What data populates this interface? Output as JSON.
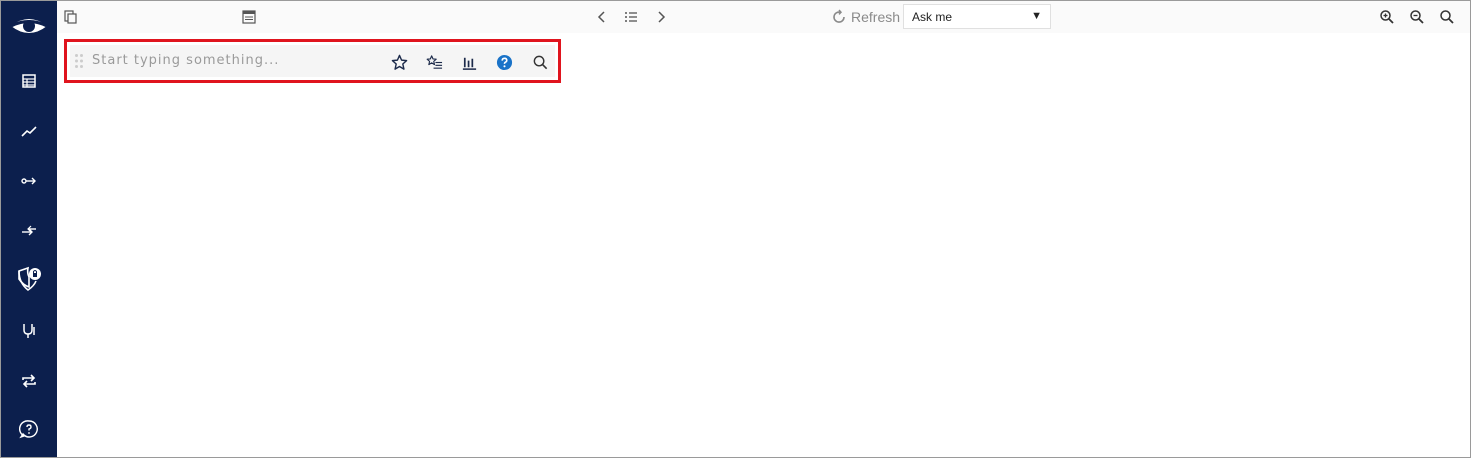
{
  "sidebar": {
    "logo": "eye-logo",
    "items": [
      {
        "icon": "table-icon"
      },
      {
        "icon": "trend-line-icon"
      },
      {
        "icon": "node-arrow-icon"
      },
      {
        "icon": "swap-arrows-icon"
      },
      {
        "icon": "shield-lock-icon"
      },
      {
        "icon": "stethoscope-icon"
      },
      {
        "icon": "repeat-icon"
      },
      {
        "icon": "help-bubble-icon"
      }
    ]
  },
  "toolbar": {
    "refresh_label": "Refresh",
    "ask_select_value": "Ask me"
  },
  "search": {
    "placeholder": "Start typing something..."
  },
  "colors": {
    "sidebar_bg": "#0c1f4d",
    "highlight_border": "#e0141e",
    "help_blue": "#1a73c8"
  }
}
